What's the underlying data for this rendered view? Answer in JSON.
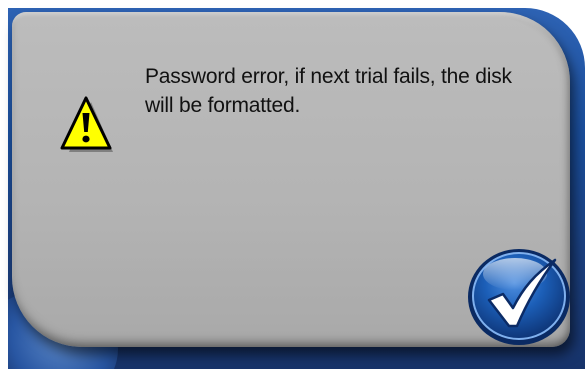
{
  "dialog": {
    "message": "Password error, if next trial fails, the disk will be formatted.",
    "icon": "warning-icon",
    "ok_icon": "checkmark-icon"
  },
  "colors": {
    "panel": "#b8b8b8",
    "frame_blue": "#1a4e9c",
    "warning_yellow": "#ffff00",
    "button_blue": "#1c5fb8"
  }
}
